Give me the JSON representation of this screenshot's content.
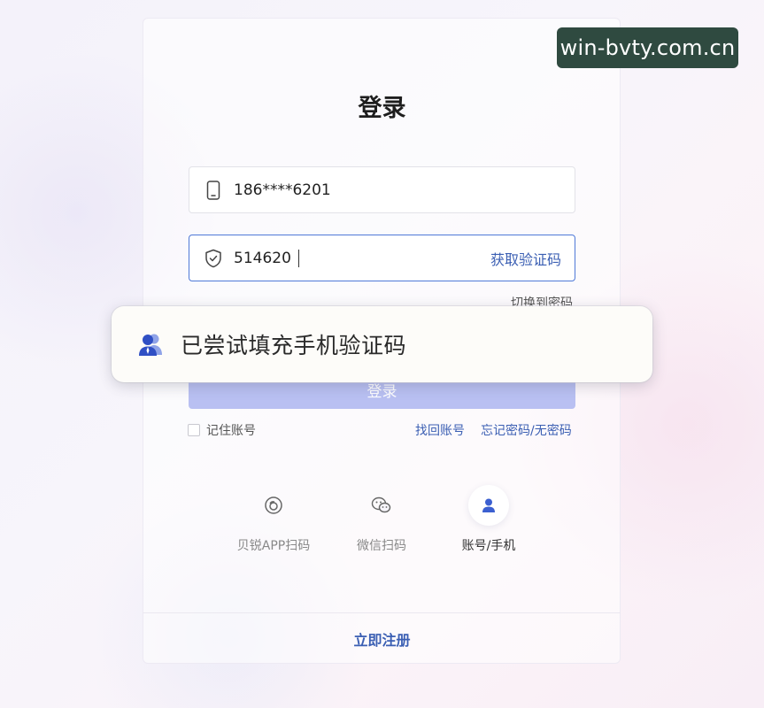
{
  "watermark": "win-bvty.com.cn",
  "title": "登录",
  "phone": {
    "value": "186****6201"
  },
  "code": {
    "value": "514620",
    "get_code": "获取验证码"
  },
  "switch_link": "切换到密码",
  "login_button": "登录",
  "toast": {
    "text": "已尝试填充手机验证码"
  },
  "remember": "记住账号",
  "links": {
    "recover": "找回账号",
    "forgot": "忘记密码/无密码"
  },
  "methods": [
    {
      "label": "贝锐APP扫码",
      "icon": "scan-icon"
    },
    {
      "label": "微信扫码",
      "icon": "wechat-icon"
    },
    {
      "label": "账号/手机",
      "icon": "user-icon"
    }
  ],
  "register": "立即注册",
  "colors": {
    "accent": "#3b5fb3",
    "button": "#b9c0f2",
    "watermark_bg": "#2f4a40"
  }
}
